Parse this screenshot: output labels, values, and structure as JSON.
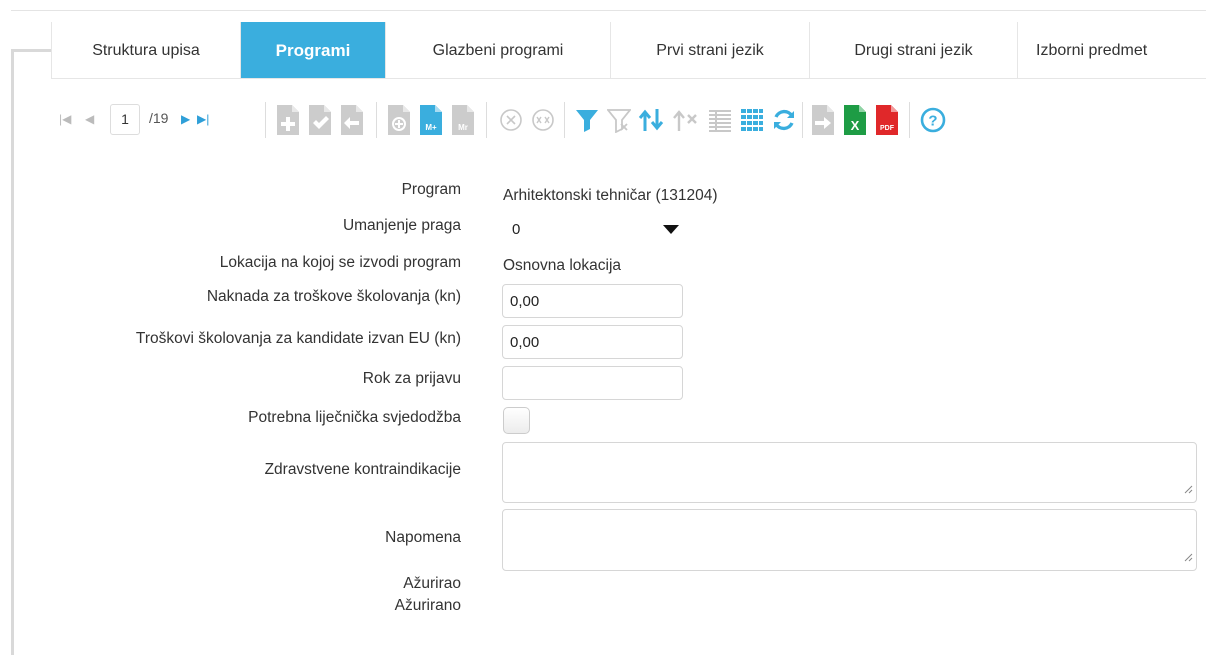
{
  "tabs": [
    {
      "label": "Struktura upisa",
      "active": false
    },
    {
      "label": "Programi",
      "active": true
    },
    {
      "label": "Glazbeni programi",
      "active": false
    },
    {
      "label": "Prvi strani jezik",
      "active": false
    },
    {
      "label": "Drugi strani jezik",
      "active": false
    },
    {
      "label": "Izborni predmet",
      "active": false
    }
  ],
  "pager": {
    "current_page": "1",
    "total_label": "/19"
  },
  "toolbar": {
    "icons": [
      "first-page-icon",
      "previous-page-icon",
      "next-page-icon",
      "last-page-icon",
      "add-record-icon",
      "confirm-record-icon",
      "undo-record-icon",
      "add-document-icon",
      "mark-add-icon",
      "mark-remove-icon",
      "cancel-icon",
      "cancel-all-icon",
      "filter-icon",
      "clear-filter-icon",
      "sort-icon",
      "clear-sort-icon",
      "columns-icon",
      "grid-icon",
      "refresh-icon",
      "export-icon",
      "excel-export-icon",
      "pdf-export-icon",
      "help-icon"
    ],
    "badges": {
      "mark_add": "M+",
      "mark_remove": "Mr",
      "excel": "X",
      "pdf": "PDF"
    },
    "colors": {
      "accent": "#3aaede",
      "inactive": "#cccccc",
      "excel": "#1e9c45",
      "pdf": "#e0282a"
    }
  },
  "form": {
    "program_label": "Program",
    "program_value": "Arhitektonski tehničar (131204)",
    "threshold_label": "Umanjenje praga",
    "threshold_value": "0",
    "location_label": "Lokacija na kojoj se izvodi program",
    "location_value": "Osnovna lokacija",
    "fee_label": "Naknada za troškove školovanja (kn)",
    "fee_value": "0,00",
    "fee_non_eu_label": "Troškovi školovanja za kandidate izvan EU (kn)",
    "fee_non_eu_value": "0,00",
    "deadline_label": "Rok za prijavu",
    "deadline_value": "",
    "medical_label": "Potrebna liječnička svjedodžba",
    "medical_checked": false,
    "contraindications_label": "Zdravstvene kontraindikacije",
    "contraindications_value": "",
    "note_label": "Napomena",
    "note_value": "",
    "updated_by_label": "Ažurirao",
    "updated_at_label": "Ažurirano"
  }
}
